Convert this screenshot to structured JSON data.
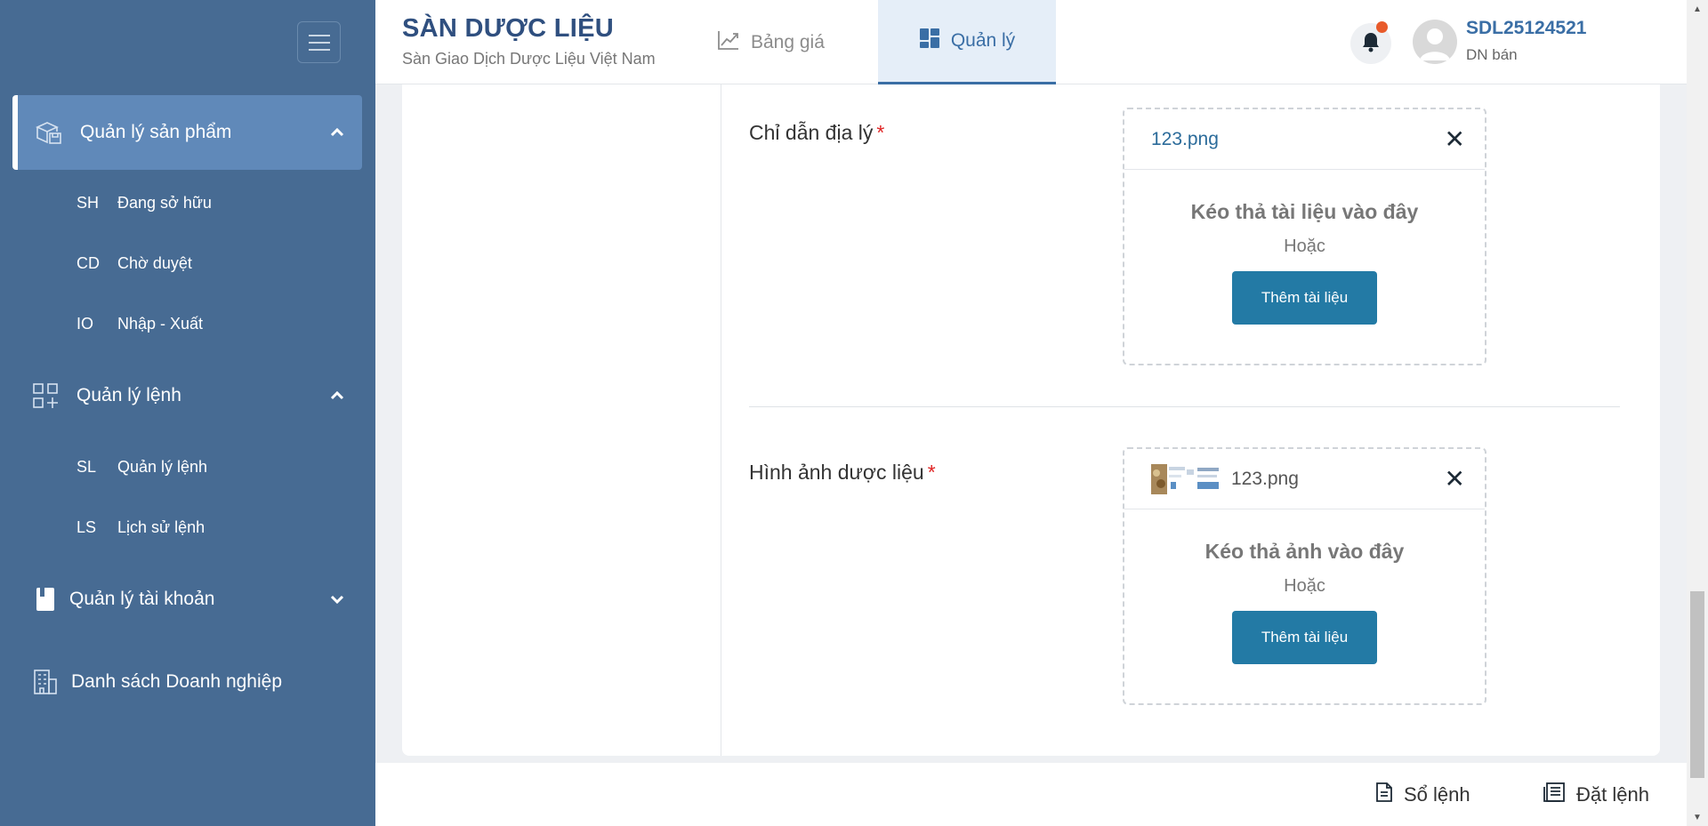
{
  "sidebar": {
    "groups": [
      {
        "label": "Quản lý sản phẩm",
        "icon": "boxes-icon",
        "expanded": true
      },
      {
        "label": "Quản lý lệnh",
        "icon": "grid-add-icon",
        "expanded": true
      },
      {
        "label": "Quản lý tài khoản",
        "icon": "account-book-icon",
        "expanded": false
      },
      {
        "label": "Danh sách Doanh nghiệp",
        "icon": "building-icon"
      }
    ],
    "product_items": [
      {
        "code": "SH",
        "label": "Đang sở hữu"
      },
      {
        "code": "CD",
        "label": "Chờ duyệt"
      },
      {
        "code": "IO",
        "label": "Nhập - Xuất"
      }
    ],
    "order_items": [
      {
        "code": "SL",
        "label": "Quản lý lệnh"
      },
      {
        "code": "LS",
        "label": "Lịch sử lệnh"
      }
    ]
  },
  "header": {
    "brand_title": "SÀN DƯỢC LIỆU",
    "brand_subtitle": "Sàn Giao Dịch Dược Liệu Việt Nam",
    "tabs": [
      {
        "label": "Bảng giá",
        "icon": "chart-line-icon",
        "active": false
      },
      {
        "label": "Quản lý",
        "icon": "dashboard-icon",
        "active": true
      }
    ],
    "user_id": "SDL25124521",
    "user_role": "DN bán"
  },
  "form": {
    "geo": {
      "label": "Chỉ dẫn địa lý",
      "required_mark": "*",
      "file_name": "123.png",
      "drop_text": "Kéo thả tài liệu vào đây",
      "or_text": "Hoặc",
      "button_label": "Thêm tài liệu"
    },
    "image": {
      "label": "Hình ảnh dược liệu",
      "required_mark": "*",
      "file_name": "123.png",
      "drop_text": "Kéo thả ảnh vào đây",
      "or_text": "Hoặc",
      "button_label": "Thêm tài liệu"
    }
  },
  "footer": {
    "order_book_label": "Sổ lệnh",
    "place_order_label": "Đặt lệnh"
  },
  "colors": {
    "sidebar_bg": "#476b93",
    "sidebar_active": "#6089b9",
    "brand": "#2f4f7f",
    "accent": "#3a6ea5",
    "button": "#237aa5",
    "required": "#e02424",
    "notification": "#e85a2a"
  }
}
